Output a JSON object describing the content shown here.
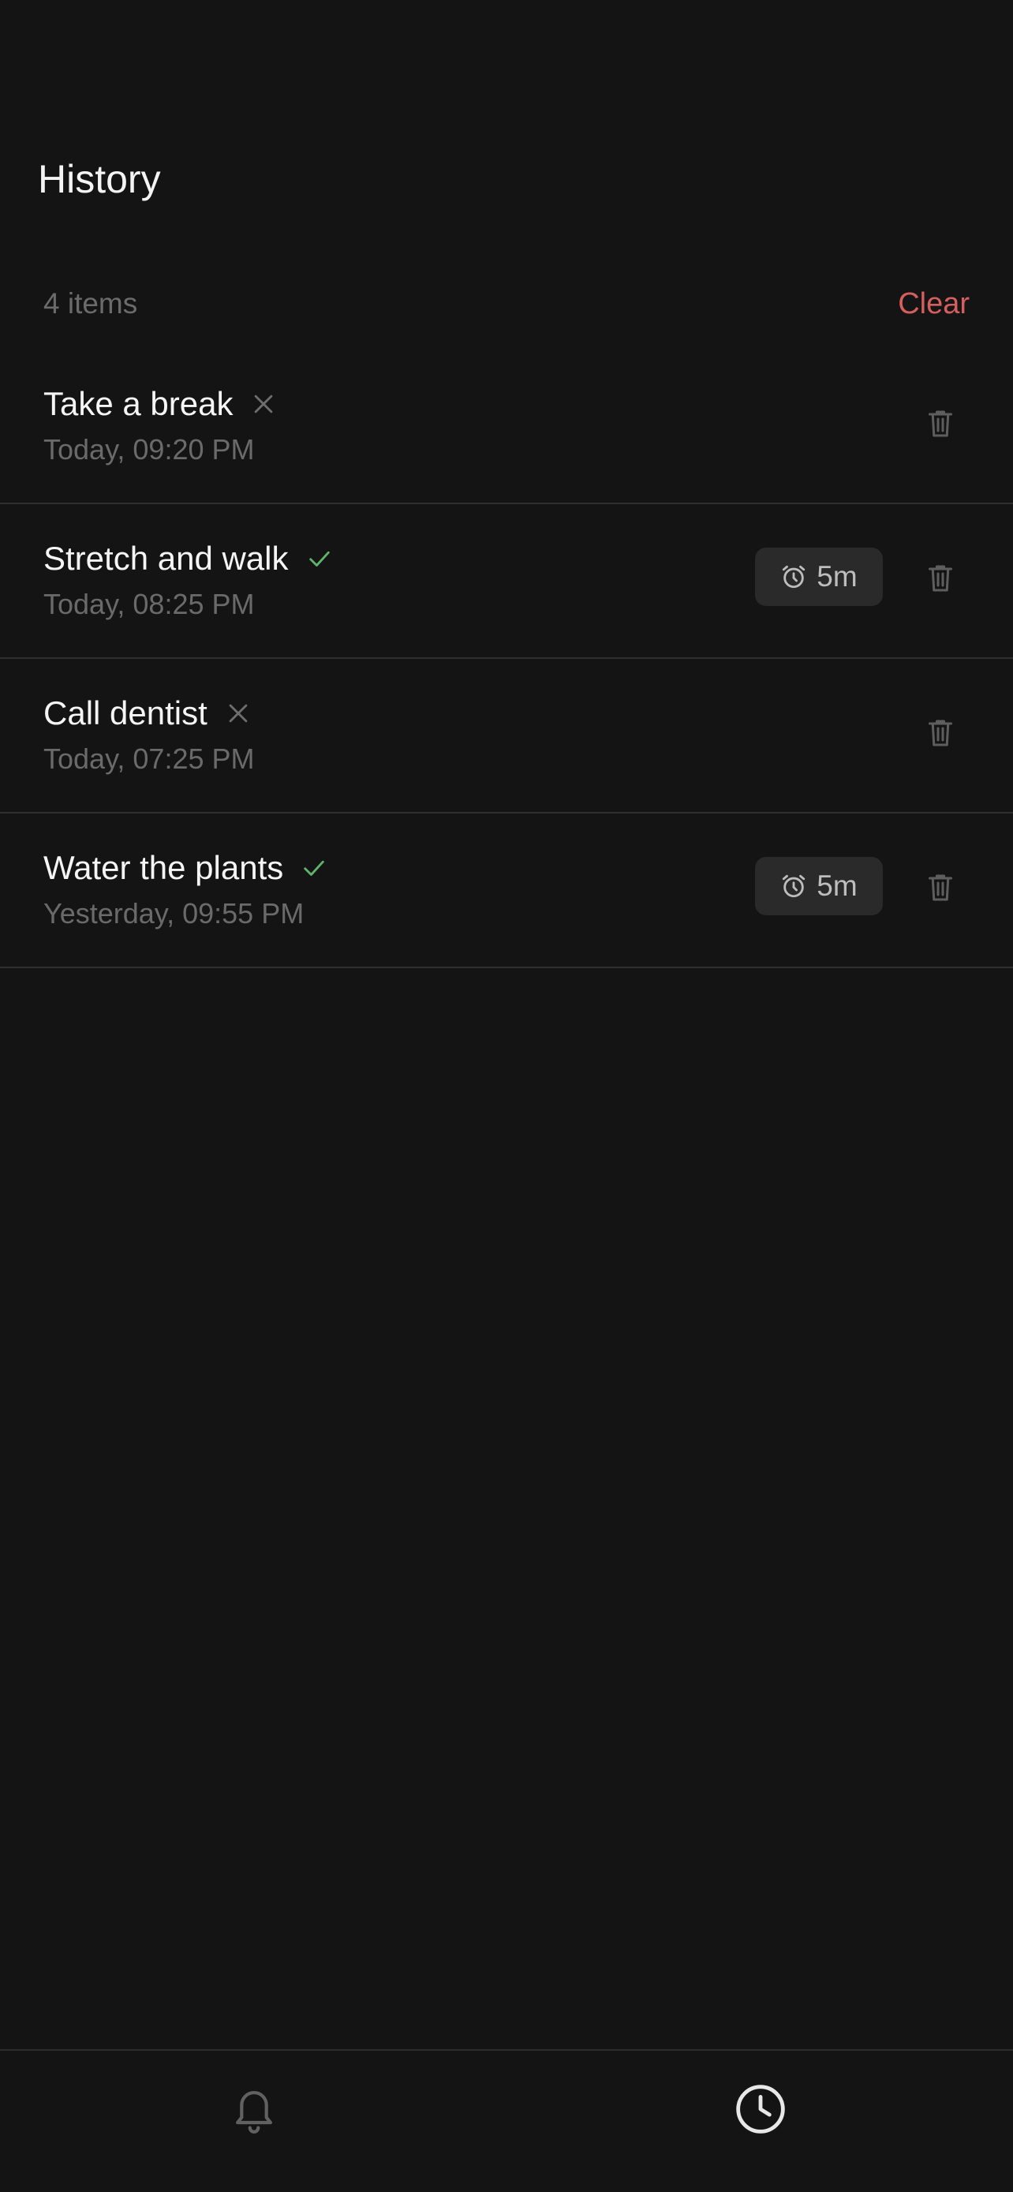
{
  "header": {
    "title": "History"
  },
  "list": {
    "count_label": "4 items",
    "clear_label": "Clear",
    "items": [
      {
        "title": "Take a break",
        "time": "Today, 09:20 PM",
        "status": "dismissed",
        "snooze": null
      },
      {
        "title": "Stretch and walk",
        "time": "Today, 08:25 PM",
        "status": "done",
        "snooze": "5m"
      },
      {
        "title": "Call dentist",
        "time": "Today, 07:25 PM",
        "status": "dismissed",
        "snooze": null
      },
      {
        "title": "Water the plants",
        "time": "Yesterday, 09:55 PM",
        "status": "done",
        "snooze": "5m"
      }
    ]
  },
  "tabs": [
    {
      "name": "reminders",
      "icon": "bell-icon",
      "active": false
    },
    {
      "name": "history",
      "icon": "clock-icon",
      "active": true
    }
  ],
  "colors": {
    "background": "#141414",
    "accent_destructive": "#d3605e",
    "success": "#5fb36a",
    "muted": "#6b6b6b"
  }
}
